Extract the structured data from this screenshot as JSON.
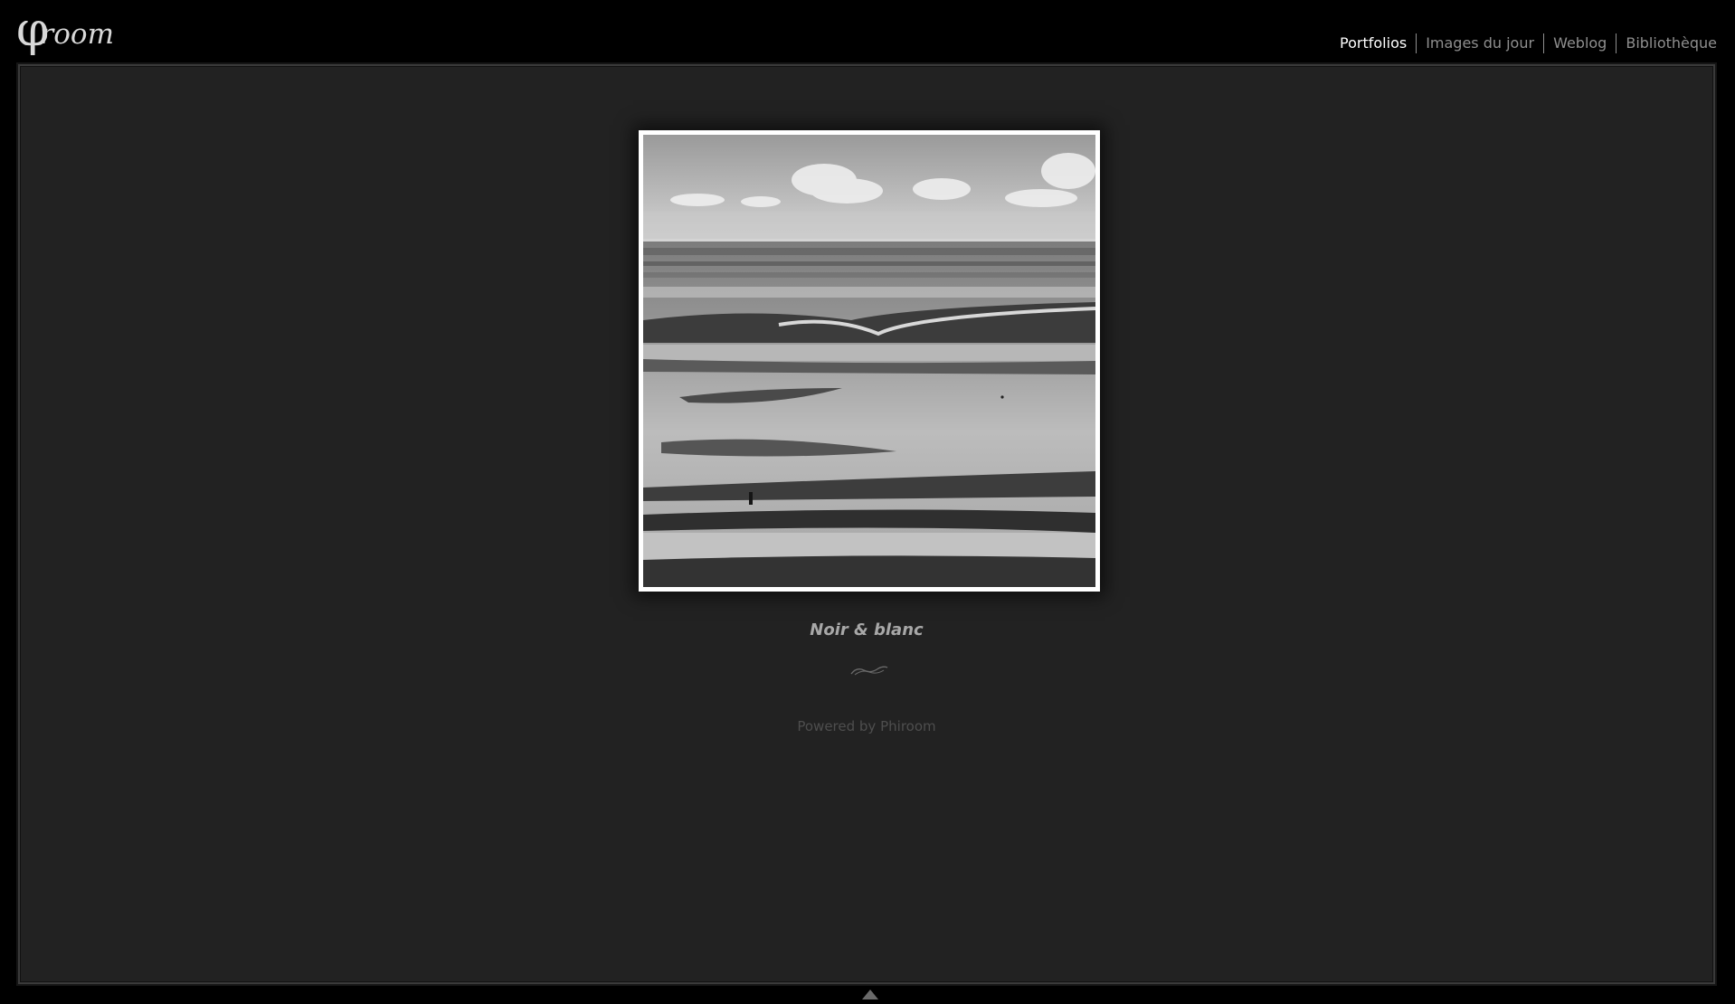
{
  "header": {
    "logo_glyph": "φ",
    "logo_word": "room",
    "nav": [
      {
        "label": "Portfolios",
        "active": true
      },
      {
        "label": "Images du jour",
        "active": false
      },
      {
        "label": "Weblog",
        "active": false
      },
      {
        "label": "Bibliothèque",
        "active": false
      }
    ]
  },
  "main": {
    "photo_title": "Noir & blanc",
    "powered_prefix": "Powered by",
    "powered_link": "Phiroom"
  },
  "colors": {
    "background": "#000000",
    "frame": "#222222",
    "nav_active": "#ffffff",
    "nav_inactive": "#8f8f8f"
  },
  "icons": [
    "ornament-icon",
    "scroll-up-icon"
  ]
}
